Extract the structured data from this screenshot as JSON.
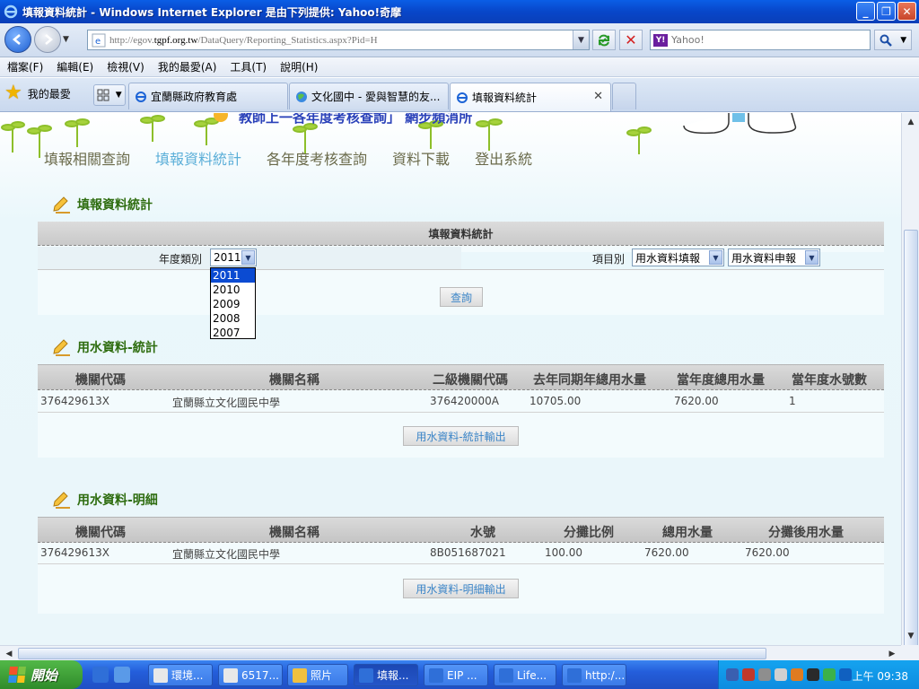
{
  "window": {
    "title": "填報資料統計 - Windows Internet Explorer 是由下列提供: Yahoo!奇摩",
    "minimize": "_",
    "maximize": "❐",
    "close": "✕"
  },
  "address": {
    "url_prefix": "http://egov.",
    "url_domain": "tgpf.org.tw",
    "url_path": "/DataQuery/Reporting_Statistics.aspx?Pid=H"
  },
  "search": {
    "placeholder": "Yahoo!",
    "provider_badge": "Y!"
  },
  "menu": [
    "檔案(F)",
    "編輯(E)",
    "檢視(V)",
    "我的最愛(A)",
    "工具(T)",
    "說明(H)"
  ],
  "favorites_label": "我的最愛",
  "tabs": [
    {
      "label": "宜蘭縣政府教育處",
      "active": false
    },
    {
      "label": "文化國中 - 愛與智慧的友...",
      "active": false
    },
    {
      "label": "填報資料統計",
      "active": true
    }
  ],
  "page": {
    "banner_title": "教師上一各年度考核查詢」 網步頻消所",
    "nav": [
      {
        "label": "填報相關查詢",
        "active": false
      },
      {
        "label": "填報資料統計",
        "active": true
      },
      {
        "label": "各年度考核查詢",
        "active": false
      },
      {
        "label": "資料下載",
        "active": false
      },
      {
        "label": "登出系統",
        "active": false
      }
    ],
    "section1_heading": "填報資料統計",
    "stats_header": "填報資料統計",
    "year_label": "年度類別",
    "year_value": "2011",
    "year_options": [
      "2011",
      "2010",
      "2009",
      "2008",
      "2007"
    ],
    "item_label": "項目別",
    "item_select1": "用水資料填報",
    "item_select2": "用水資料申報",
    "query_button": "查詢",
    "section2_heading": "用水資料-統計",
    "stats_table": {
      "headers": [
        "機關代碼",
        "機關名稱",
        "二級機關代碼",
        "去年同期年總用水量",
        "當年度總用水量",
        "當年度水號數"
      ],
      "rows": [
        [
          "376429613X",
          "宜蘭縣立文化國民中學",
          "376420000A",
          "10705.00",
          "7620.00",
          "1"
        ]
      ]
    },
    "stats_export_button": "用水資料-統計輸出",
    "section3_heading": "用水資料-明細",
    "detail_table": {
      "headers": [
        "機關代碼",
        "機關名稱",
        "水號",
        "分攤比例",
        "總用水量",
        "分攤後用水量"
      ],
      "rows": [
        [
          "376429613X",
          "宜蘭縣立文化國民中學",
          "8B051687021",
          "100.00",
          "7620.00",
          "7620.00"
        ]
      ]
    },
    "detail_export_button": "用水資料-明細輸出"
  },
  "taskbar": {
    "start": "開始",
    "tasks": [
      {
        "label": "環境...",
        "active": false
      },
      {
        "label": "6517...",
        "active": false
      },
      {
        "label": "照片",
        "active": false
      },
      {
        "label": "填報...",
        "active": true
      },
      {
        "label": "EIP ...",
        "active": false
      },
      {
        "label": "Life...",
        "active": false
      },
      {
        "label": "http:/...",
        "active": false
      }
    ],
    "clock": "上午 09:38"
  },
  "colors": {
    "title_bar": "#0846c9",
    "nav_active": "#5aaed8",
    "section_heading": "#2f6d10",
    "dropdown_selected": "#0b4bd2"
  }
}
